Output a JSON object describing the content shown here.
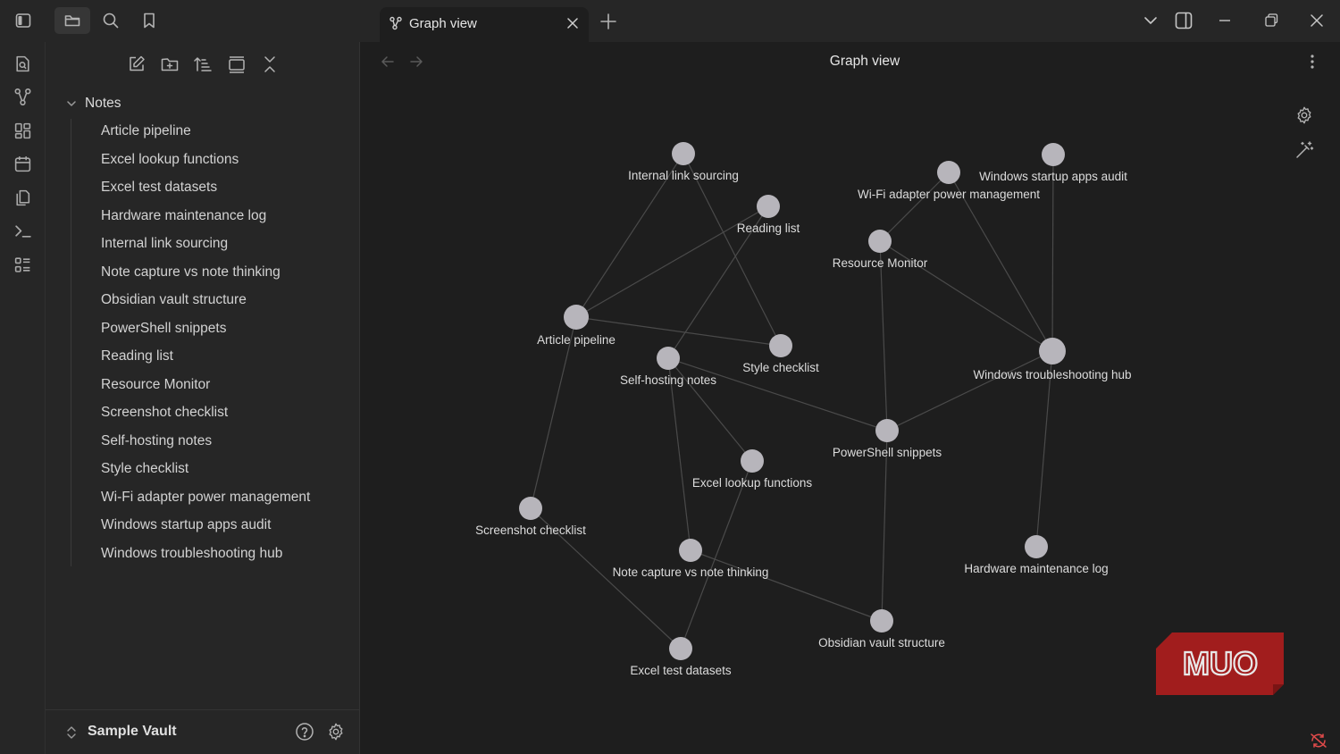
{
  "titlebar": {
    "tab_title": "Graph view",
    "icons": [
      "sidebar-toggle-icon",
      "folder-icon",
      "search-icon",
      "bookmark-icon",
      "graph-icon",
      "close-icon",
      "plus-icon",
      "chevron-down-icon",
      "right-sidebar-icon",
      "minimize-icon",
      "restore-icon",
      "close-window-icon"
    ]
  },
  "ribbon": {
    "icons": [
      "quick-switcher-icon",
      "graph-icon",
      "canvas-icon",
      "calendar-icon",
      "templates-icon",
      "command-palette-icon",
      "bases-icon"
    ]
  },
  "sidebar": {
    "toolbar_icons": [
      "new-note-icon",
      "new-folder-icon",
      "sort-icon",
      "collapse-view-icon",
      "collapse-all-icon"
    ],
    "folder": "Notes",
    "files": [
      "Article pipeline",
      "Excel lookup functions",
      "Excel test datasets",
      "Hardware maintenance log",
      "Internal link sourcing",
      "Note capture vs note thinking",
      "Obsidian vault structure",
      "PowerShell snippets",
      "Reading list",
      "Resource Monitor",
      "Screenshot checklist",
      "Self-hosting notes",
      "Style checklist",
      "Wi-Fi adapter power management",
      "Windows startup apps audit",
      "Windows troubleshooting hub"
    ],
    "vault_name": "Sample Vault"
  },
  "main": {
    "view_title": "Graph view"
  },
  "graph": {
    "nodes": [
      {
        "id": "ils",
        "label": "Internal link sourcing"
      },
      {
        "id": "wifi",
        "label": "Wi-Fi adapter power management"
      },
      {
        "id": "wsa",
        "label": "Windows startup apps audit"
      },
      {
        "id": "rl",
        "label": "Reading list"
      },
      {
        "id": "rm",
        "label": "Resource Monitor"
      },
      {
        "id": "ap",
        "label": "Article pipeline"
      },
      {
        "id": "sc",
        "label": "Style checklist"
      },
      {
        "id": "wth",
        "label": "Windows troubleshooting hub"
      },
      {
        "id": "shn",
        "label": "Self-hosting notes"
      },
      {
        "id": "ps",
        "label": "PowerShell snippets"
      },
      {
        "id": "elf",
        "label": "Excel lookup functions"
      },
      {
        "id": "scl",
        "label": "Screenshot checklist"
      },
      {
        "id": "nc",
        "label": "Note capture vs note thinking"
      },
      {
        "id": "hml",
        "label": "Hardware maintenance log"
      },
      {
        "id": "ovs",
        "label": "Obsidian vault structure"
      },
      {
        "id": "etd",
        "label": "Excel test datasets"
      }
    ],
    "links": [
      [
        "ils",
        "ap"
      ],
      [
        "ils",
        "sc"
      ],
      [
        "rl",
        "ap"
      ],
      [
        "rl",
        "shn"
      ],
      [
        "ap",
        "sc"
      ],
      [
        "ap",
        "scl"
      ],
      [
        "wifi",
        "rm"
      ],
      [
        "wifi",
        "wth"
      ],
      [
        "wsa",
        "wth"
      ],
      [
        "rm",
        "wth"
      ],
      [
        "rm",
        "ps"
      ],
      [
        "wth",
        "ps"
      ],
      [
        "wth",
        "hml"
      ],
      [
        "shn",
        "ps"
      ],
      [
        "shn",
        "elf"
      ],
      [
        "shn",
        "nc"
      ],
      [
        "ps",
        "ovs"
      ],
      [
        "elf",
        "etd"
      ],
      [
        "scl",
        "etd"
      ],
      [
        "nc",
        "ovs"
      ]
    ]
  },
  "watermark": "MUO"
}
